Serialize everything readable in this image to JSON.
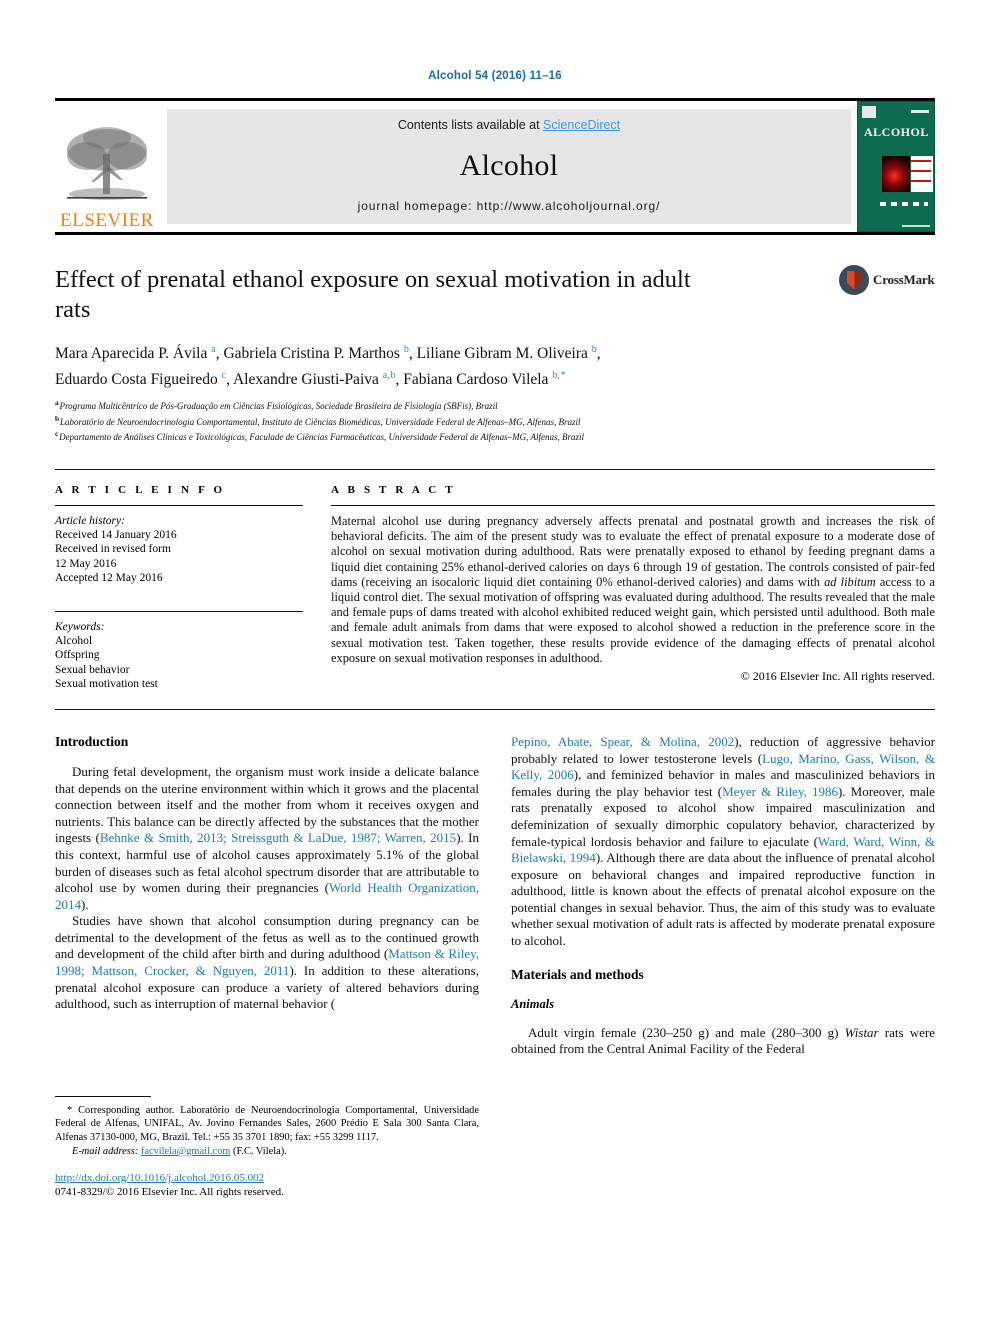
{
  "running_head": "Alcohol 54 (2016) 11–16",
  "masthead": {
    "publisher": "ELSEVIER",
    "contents_prefix": "Contents lists available at ",
    "contents_link": "ScienceDirect",
    "journal_name": "Alcohol",
    "homepage": "journal homepage: http://www.alcoholjournal.org/",
    "cover_title": "ALCOHOL"
  },
  "article": {
    "title": "Effect of prenatal ethanol exposure on sexual motivation in adult rats",
    "authors_line_1": "Mara Aparecida P. Ávila a, Gabriela Cristina P. Marthos b, Liliane Gibram M. Oliveira b,",
    "authors_line_2": "Eduardo Costa Figueiredo c, Alexandre Giusti-Paiva a,b, Fabiana Cardoso Vilela b,*",
    "affiliation_a": "Programa Multicêntrico de Pós-Graduação em Ciências Fisiológicas, Sociedade Brasileira de Fisiologia (SBFis), Brazil",
    "affiliation_b": "Laboratório de Neuroendocrinologia Comportamental, Instituto de Ciências Biomédicas, Universidade Federal de Alfenas–MG, Alfenas, Brazil",
    "affiliation_c": "Departamento de Análises Clínicas e Toxicológicas, Faculade de Ciências Farmacêuticas, Universidade Federal de Alfenas–MG, Alfenas, Brazil",
    "crossmark_label": "CrossMark"
  },
  "article_info": {
    "heading": "A R T I C L E  I N F O",
    "history_label": "Article history:",
    "history": [
      "Received 14 January 2016",
      "Received in revised form",
      "12 May 2016",
      "Accepted 12 May 2016"
    ],
    "keywords_label": "Keywords:",
    "keywords": [
      "Alcohol",
      "Offspring",
      "Sexual behavior",
      "Sexual motivation test"
    ]
  },
  "abstract": {
    "heading": "A B S T R A C T",
    "part_1": "Maternal alcohol use during pregnancy adversely affects prenatal and postnatal growth and increases the risk of behavioral deficits. The aim of the present study was to evaluate the effect of prenatal exposure to a moderate dose of alcohol on sexual motivation during adulthood. Rats were prenatally exposed to ethanol by feeding pregnant dams a liquid diet containing 25% ethanol-derived calories on days 6 through 19 of gestation. The controls consisted of pair-fed dams (receiving an isocaloric liquid diet containing 0% ethanol-derived calories) and dams with ",
    "italic_1": "ad libitum",
    "part_2": " access to a liquid control diet. The sexual motivation of offspring was evaluated during adulthood. The results revealed that the male and female pups of dams treated with alcohol exhibited reduced weight gain, which persisted until adulthood. Both male and female adult animals from dams that were exposed to alcohol showed a reduction in the preference score in the sexual motivation test. Taken together, these results provide evidence of the damaging effects of prenatal alcohol exposure on sexual motivation responses in adulthood.",
    "copyright": "© 2016 Elsevier Inc. All rights reserved."
  },
  "body": {
    "introduction_heading": "Introduction",
    "intro_p1_a": "During fetal development, the organism must work inside a delicate balance that depends on the uterine environment within which it grows and the placental connection between itself and the mother from whom it receives oxygen and nutrients. This balance can be directly affected by the substances that the mother ingests (",
    "intro_p1_ref1": "Behnke & Smith, 2013; Streissguth & LaDue, 1987; Warren, 2015",
    "intro_p1_b": "). In this context, harmful use of alcohol causes approximately 5.1% of the global burden of diseases such as fetal alcohol spectrum disorder that are attributable to alcohol use by women during their pregnancies (",
    "intro_p1_ref2": "World Health Organization, 2014",
    "intro_p1_c": ").",
    "intro_p2_a": "Studies have shown that alcohol consumption during pregnancy can be detrimental to the development of the fetus as well as to the continued growth and development of the child after birth and during adulthood (",
    "intro_p2_ref1": "Mattson & Riley, 1998; Mattson, Crocker, & Nguyen, 2011",
    "intro_p2_b": "). In addition to these alterations, prenatal alcohol exposure can produce a variety of altered behaviors during adulthood, such as interruption of maternal behavior (",
    "intro_p2_ref2": "Pepino, Abate, Spear, & Molina, 2002",
    "intro_p2_c": "), reduction of aggressive behavior probably related to lower testosterone levels (",
    "intro_p2_ref3": "Lugo, Marino, Gass, Wilson, & Kelly, 2006",
    "intro_p2_d": "), and feminized behavior in males and masculinized behaviors in females during the play behavior test (",
    "intro_p2_ref4": "Meyer & Riley, 1986",
    "intro_p2_e": "). Moreover, male rats prenatally exposed to alcohol show impaired masculinization and defeminization of sexually dimorphic copulatory behavior, characterized by female-typical lordosis behavior and failure to ejaculate (",
    "intro_p2_ref5": "Ward, Ward, Winn, & Bielawski, 1994",
    "intro_p2_f": "). Although there are data about the influence of prenatal alcohol exposure on behavioral changes and impaired reproductive function in adulthood, little is known about the effects of prenatal alcohol exposure on the potential changes in sexual behavior. Thus, the aim of this study was to evaluate whether sexual motivation of adult rats is affected by moderate prenatal exposure to alcohol.",
    "methods_heading": "Materials and methods",
    "animals_subheading": "Animals",
    "animals_p1_a": "Adult virgin female (230–250 g) and male (280–300 g) ",
    "animals_p1_italic": "Wistar",
    "animals_p1_b": " rats were obtained from the Central Animal Facility of the Federal"
  },
  "footnote": {
    "corresponding": "* Corresponding author. Laboratório de Neuroendocrinologia Comportamental, Universidade Federal de Alfenas, UNIFAL, Av. Jovino Fernandes Sales, 2600 Prédio E Sala 300 Santa Clara, Alfenas 37130-000, MG, Brazil. Tel.: +55 35 3701 1890; fax: +55 3299 1117.",
    "email_label": "E-mail address:",
    "email": "facvilela@gmail.com",
    "email_attrib": "(F.C. Vilela).",
    "doi": "http://dx.doi.org/10.1016/j.alcohol.2016.05.002",
    "issn_line": "0741-8329/© 2016 Elsevier Inc. All rights reserved."
  },
  "colors": {
    "link_blue": "#1a7cb8",
    "elsevier_orange": "#f07f13",
    "cover_green": "#0d6b4f"
  }
}
